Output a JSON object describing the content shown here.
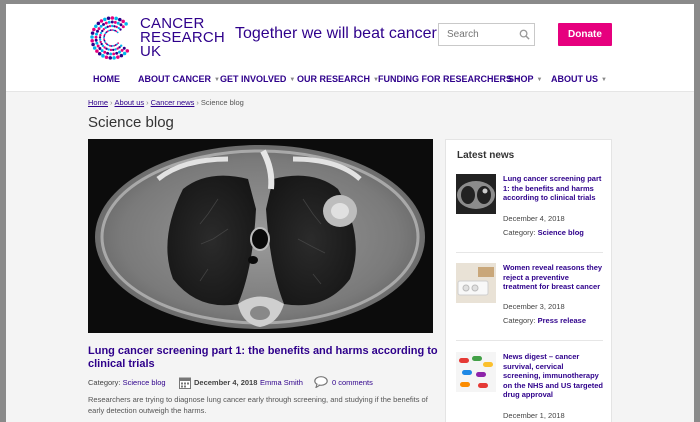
{
  "header": {
    "logo_lines": [
      "CANCER",
      "RESEARCH",
      "UK"
    ],
    "tagline": "Together we will beat cancer",
    "search_placeholder": "Search",
    "donate_label": "Donate"
  },
  "nav": {
    "items": [
      {
        "label": "HOME",
        "dropdown": false
      },
      {
        "label": "ABOUT CANCER",
        "dropdown": true
      },
      {
        "label": "GET INVOLVED",
        "dropdown": true
      },
      {
        "label": "OUR RESEARCH",
        "dropdown": true
      },
      {
        "label": "FUNDING FOR RESEARCHERS",
        "dropdown": true
      },
      {
        "label": "SHOP",
        "dropdown": true
      },
      {
        "label": "ABOUT US",
        "dropdown": true
      }
    ],
    "caret": "▼"
  },
  "breadcrumb": {
    "items": [
      "Home",
      "About us",
      "Cancer news"
    ],
    "current": "Science blog",
    "separator": "›"
  },
  "page_title": "Science blog",
  "article": {
    "title": "Lung cancer screening part 1: the benefits and harms according to clinical trials",
    "category_label": "Category:",
    "category": "Science blog",
    "date": "December 4, 2018",
    "author": "Emma Smith",
    "comments": "0 comments",
    "excerpt": "Researchers are trying to diagnose lung cancer early through screening, and studying if the benefits of early detection outweigh the harms."
  },
  "sidebar": {
    "heading": "Latest news",
    "category_label": "Category:",
    "items": [
      {
        "title": "Lung cancer screening part 1: the benefits and harms according to clinical trials",
        "date": "December 4, 2018",
        "category": "Science blog"
      },
      {
        "title": "Women reveal reasons they reject a preventive treatment for breast cancer",
        "date": "December 3, 2018",
        "category": "Press release"
      },
      {
        "title": "News digest – cancer survival, cervical screening, immunotherapy on the NHS and US targeted drug approval",
        "date": "December 1, 2018",
        "category": ""
      }
    ]
  },
  "colors": {
    "brand_purple": "#2e008b",
    "donate_pink": "#e6007e",
    "logo_accents": [
      "#e6007e",
      "#00b6ed",
      "#2e008b"
    ]
  }
}
